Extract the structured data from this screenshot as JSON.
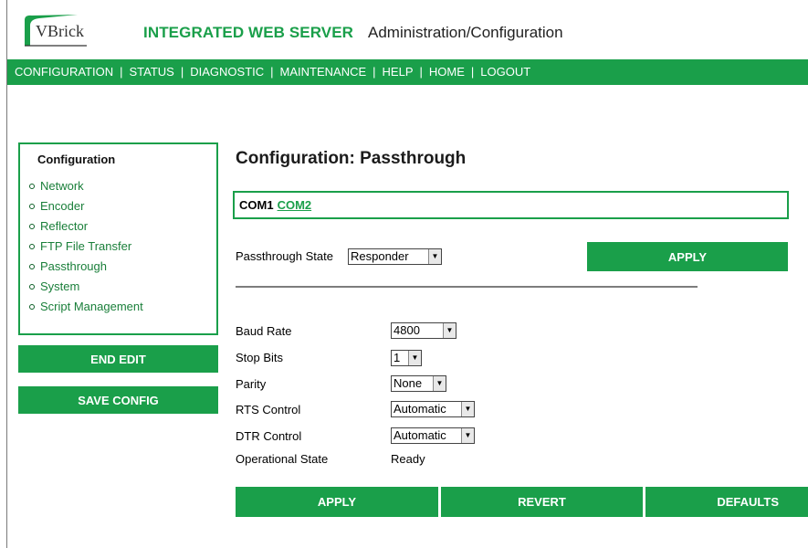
{
  "header": {
    "logo_text": "VBrick",
    "title": "INTEGRATED WEB SERVER",
    "subtitle": "Administration/Configuration"
  },
  "nav": [
    "CONFIGURATION",
    "STATUS",
    "DIAGNOSTIC",
    "MAINTENANCE",
    "HELP",
    "HOME",
    "LOGOUT"
  ],
  "sidebar": {
    "title": "Configuration",
    "items": [
      "Network",
      "Encoder",
      "Reflector",
      "FTP File Transfer",
      "Passthrough",
      "System",
      "Script Management"
    ],
    "end_edit": "END EDIT",
    "save_config": "SAVE CONFIG"
  },
  "main": {
    "title": "Configuration: Passthrough",
    "com1": "COM1",
    "com2": "COM2",
    "passthrough_label": "Passthrough State",
    "passthrough_value": "Responder",
    "apply_top": "APPLY",
    "fields": {
      "baud_label": "Baud Rate",
      "baud_value": "4800",
      "stop_label": "Stop Bits",
      "stop_value": "1",
      "parity_label": "Parity",
      "parity_value": "None",
      "rts_label": "RTS Control",
      "rts_value": "Automatic",
      "dtr_label": "DTR Control",
      "dtr_value": "Automatic",
      "op_label": "Operational State",
      "op_value": "Ready"
    },
    "buttons": {
      "apply": "APPLY",
      "revert": "REVERT",
      "defaults": "DEFAULTS"
    }
  },
  "colors": {
    "brand_green": "#1a9f4a"
  }
}
